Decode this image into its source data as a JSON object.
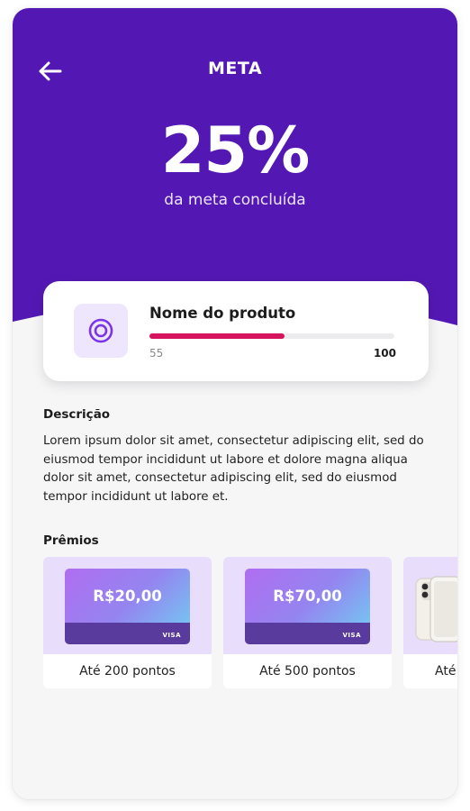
{
  "header": {
    "title": "META",
    "back_icon": "arrow-left-icon"
  },
  "hero": {
    "percent": "25%",
    "subtitle": "da meta concluída",
    "progress_fraction": 0.25,
    "background_color": "#5318b4"
  },
  "product": {
    "name": "Nome do produto",
    "icon": "target-icon",
    "current": "55",
    "target": "100",
    "progress_fraction": 0.55,
    "bar_color": "#d6135d",
    "accent_color": "#7a35e8"
  },
  "description": {
    "heading": "Descrição",
    "text": "Lorem ipsum dolor sit amet, consectetur adipiscing elit, sed do eiusmod tempor incididunt ut labore et dolore magna aliqua dolor sit amet, consectetur adipiscing elit, sed do eiusmod tempor incididunt ut labore et."
  },
  "prizes": {
    "heading": "Prêmios",
    "items": [
      {
        "amount": "R$20,00",
        "card_brand": "VISA",
        "label": "Até 200 pontos"
      },
      {
        "amount": "R$70,00",
        "card_brand": "VISA",
        "label": "Até 500 pontos"
      },
      {
        "image": "phone-icon",
        "label": "Até"
      }
    ]
  }
}
